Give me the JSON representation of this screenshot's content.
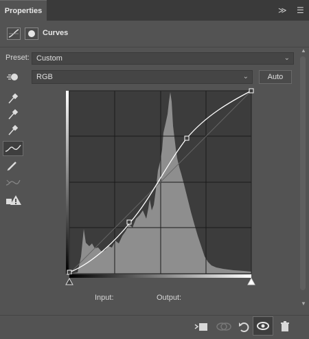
{
  "header": {
    "tab_label": "Properties"
  },
  "adjustment": {
    "title": "Curves"
  },
  "preset": {
    "label": "Preset:",
    "value": "Custom"
  },
  "channel": {
    "value": "RGB"
  },
  "buttons": {
    "auto_label": "Auto"
  },
  "io": {
    "input_label": "Input:",
    "output_label": "Output:"
  },
  "icons": {
    "collapse": "double-chevron-right-icon",
    "menu": "hamburger-menu-icon",
    "curves_adj": "curves-adjustment-icon",
    "mask": "mask-icon",
    "targeted_adjust": "targeted-adjustment-hand-icon",
    "black_eyedropper": "black-point-eyedropper-icon",
    "gray_eyedropper": "gray-point-eyedropper-icon",
    "white_eyedropper": "white-point-eyedropper-icon",
    "edit_points": "edit-points-curve-icon",
    "draw_pencil": "pencil-draw-icon",
    "smooth": "smooth-curve-icon",
    "clipping_warning": "clipping-warning-icon",
    "clip_to_layer": "clip-to-layer-icon",
    "view_previous": "view-previous-state-icon",
    "reset": "reset-icon",
    "visibility": "eye-visibility-icon",
    "delete": "trash-icon"
  },
  "colors": {
    "panel": "#535353",
    "header": "#3a3a3a",
    "graph_bg": "#3c3c3c",
    "histogram": "#8e8e8e",
    "curve": "#ffffff"
  },
  "curve_points": [
    [
      0,
      0
    ],
    [
      64,
      64
    ],
    [
      128,
      128
    ],
    [
      192,
      192
    ],
    [
      255,
      255
    ]
  ]
}
